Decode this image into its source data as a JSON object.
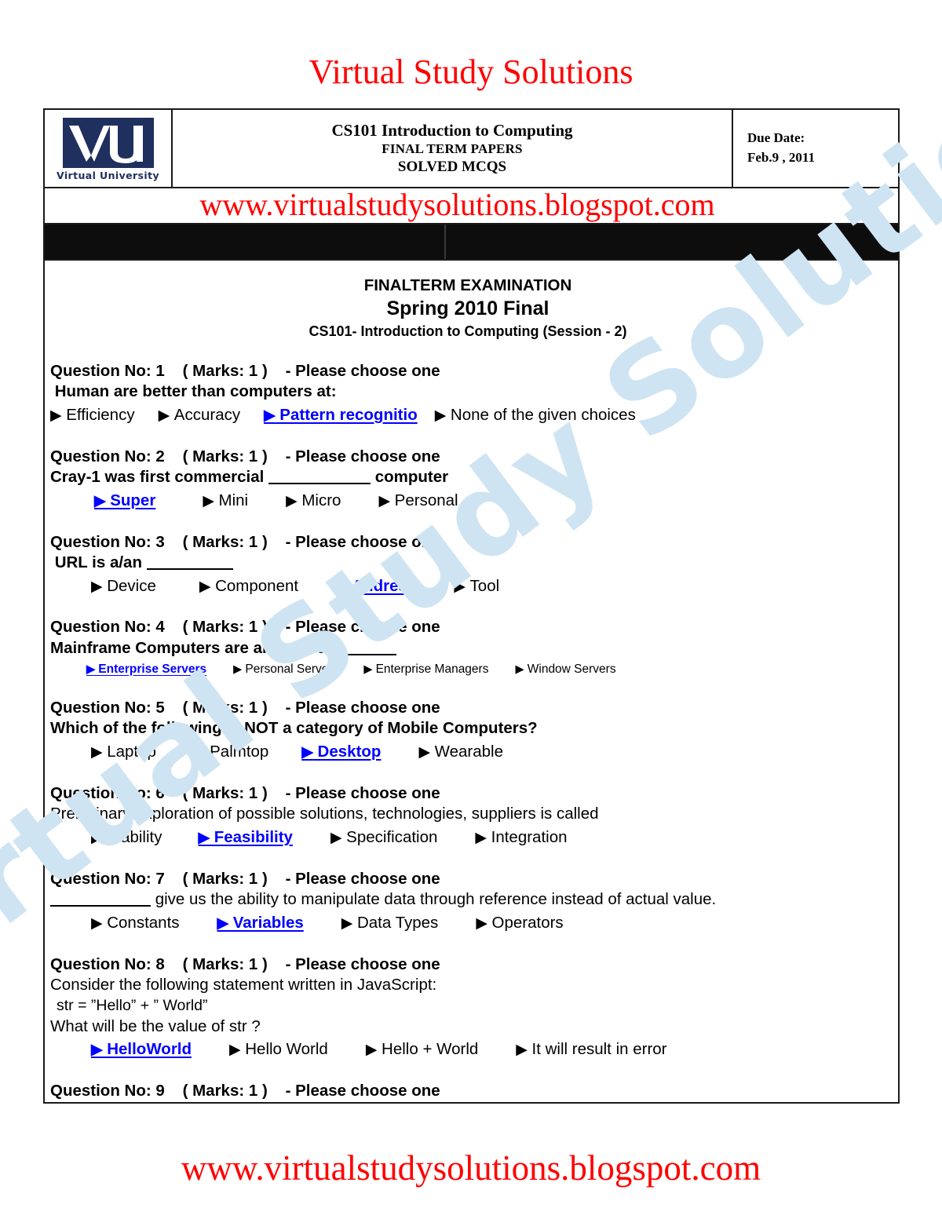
{
  "document": {
    "site_title": "Virtual Study Solutions",
    "header_url": "www.virtualstudysolutions.blogspot.com",
    "footer_url": "www.virtualstudysolutions.blogspot.com"
  },
  "header": {
    "logo": {
      "mark": "VU",
      "caption": "Virtual University"
    },
    "course_line1": "CS101 Introduction to Computing",
    "course_line2": "FINAL TERM PAPERS",
    "course_line3": "SOLVED MCQS",
    "due_label": "Due Date:",
    "due_value": "Feb.9 , 2011"
  },
  "exam": {
    "heading1": "FINALTERM EXAMINATION",
    "heading2": "Spring 2010 Final",
    "heading3": "CS101- Introduction to Computing (Session - 2)",
    "questions": [
      {
        "head": "Question No: 1    ( Marks: 1 )    - Please choose one",
        "stem": " Human are better than computers at:",
        "stem_bold": true,
        "stem_indent": false,
        "options_size": "normal",
        "options_indent": 0,
        "gaps": [
          30,
          30,
          22
        ],
        "options": [
          {
            "label": "Efficiency",
            "correct": false
          },
          {
            "label": "Accuracy",
            "correct": false
          },
          {
            "label": "Pattern recognitio",
            "correct": true
          },
          {
            "label": "None of the given choices",
            "correct": false
          }
        ]
      },
      {
        "head": "Question No: 2    ( Marks: 1 )    - Please choose one",
        "stem": "Cray-1 was first commercial ",
        "stem_blank": 130,
        "stem_after": " computer",
        "stem_bold": true,
        "stem_indent": false,
        "options_size": "normal",
        "options_indent": 56,
        "gaps": [
          60,
          48,
          48
        ],
        "options": [
          {
            "label": "Super",
            "correct": true
          },
          {
            "label": "Mini",
            "correct": false
          },
          {
            "label": "Micro",
            "correct": false
          },
          {
            "label": "Personal",
            "correct": false
          }
        ]
      },
      {
        "head": "Question No: 3    ( Marks: 1 )    - Please choose one",
        "stem": " URL is a/an ",
        "stem_blank": 110,
        "stem_after": "",
        "stem_bold": true,
        "stem_indent": false,
        "options_size": "normal",
        "options_indent": 52,
        "gaps": [
          55,
          48,
          48
        ],
        "options": [
          {
            "label": "Device",
            "correct": false
          },
          {
            "label": "Component",
            "correct": false
          },
          {
            "label": "Address",
            "correct": true
          },
          {
            "label": "Tool",
            "correct": false
          }
        ]
      },
      {
        "head": "Question No: 4    ( Marks: 1 )    - Please choose one",
        "stem": "Mainframe Computers are also called ",
        "stem_blank": 72,
        "stem_after": "",
        "stem_bold": true,
        "stem_indent": false,
        "options_size": "small",
        "options_indent": 46,
        "gaps": [
          34,
          32,
          34
        ],
        "options": [
          {
            "label": "Enterprise Servers",
            "correct": true
          },
          {
            "label": "Personal Servers",
            "correct": false
          },
          {
            "label": "Enterprise Managers",
            "correct": false
          },
          {
            "label": "Window Servers",
            "correct": false
          }
        ]
      },
      {
        "head": "Question No: 5    ( Marks: 1 )    - Please choose one",
        "stem": "Which of the following is NOT a category of Mobile Computers?",
        "stem_bold": true,
        "stem_indent": false,
        "options_size": "normal",
        "options_indent": 52,
        "gaps": [
          48,
          42,
          48
        ],
        "options": [
          {
            "label": "Laptop",
            "correct": false
          },
          {
            "label": "Palmtop",
            "correct": false
          },
          {
            "label": "Desktop",
            "correct": true
          },
          {
            "label": "Wearable",
            "correct": false
          }
        ]
      },
      {
        "head": "Question No: 6    ( Marks: 1 )    - Please choose one",
        "stem": "Preliminary exploration of possible solutions, technologies, suppliers is called",
        "stem_bold": false,
        "stem_indent": false,
        "options_size": "normal",
        "options_indent": 52,
        "gaps": [
          46,
          48,
          48
        ],
        "options": [
          {
            "label": "Viability",
            "correct": false
          },
          {
            "label": "Feasibility",
            "correct": true
          },
          {
            "label": "Specification",
            "correct": false
          },
          {
            "label": "Integration",
            "correct": false
          }
        ]
      },
      {
        "head": "Question No: 7    ( Marks: 1 )    - Please choose one",
        "stem": "",
        "stem_blank": 128,
        "stem_after": " give us the ability to manipulate data through reference instead of actual value.",
        "stem_bold": false,
        "stem_indent": false,
        "options_size": "normal",
        "options_indent": 52,
        "gaps": [
          48,
          48,
          48
        ],
        "options": [
          {
            "label": "Constants",
            "correct": false
          },
          {
            "label": "Variables",
            "correct": true
          },
          {
            "label": "Data Types",
            "correct": false
          },
          {
            "label": "Operators",
            "correct": false
          }
        ]
      },
      {
        "head": "Question No: 8    ( Marks: 1 )    - Please choose one",
        "stem": "Consider the following statement written in JavaScript:",
        "stem_bold": false,
        "stem_indent": false,
        "code": " str = ”Hello” + ” World”",
        "stem2": "What will be the value of str ?",
        "options_size": "normal",
        "options_indent": 52,
        "gaps": [
          48,
          48,
          48
        ],
        "options": [
          {
            "label": "HelloWorld",
            "correct": true
          },
          {
            "label": "Hello World",
            "correct": false
          },
          {
            "label": "Hello + World",
            "correct": false
          },
          {
            "label": "It will result in error",
            "correct": false
          }
        ]
      },
      {
        "head": "Question No: 9    ( Marks: 1 )    - Please choose one",
        "stem": "",
        "stem_bold": true,
        "stem_indent": false,
        "options_size": "normal",
        "options_indent": 0,
        "gaps": [],
        "options": []
      }
    ]
  },
  "watermark": {
    "text": "Virtual Study Solutions"
  },
  "colors": {
    "brand_red": "#ff0000",
    "answer_blue": "#0000ff",
    "logo_navy": "#1f2f5e",
    "watermark_blue": "#cfe4f2"
  }
}
